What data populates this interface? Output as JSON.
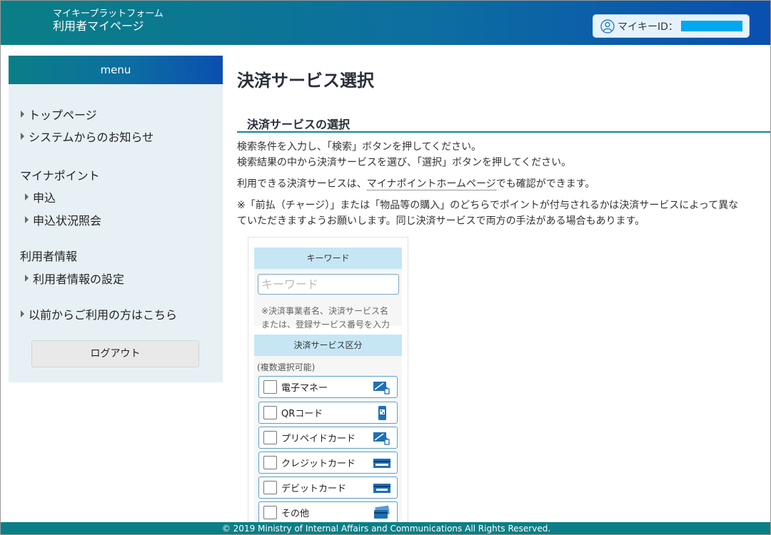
{
  "header": {
    "brand_sub": "マイキープラットフォーム",
    "brand_main": "利用者マイページ",
    "myid_label": "マイキーID："
  },
  "sidebar": {
    "menu_title": "menu",
    "items": [
      {
        "label": "トップページ"
      },
      {
        "label": "システムからのお知らせ"
      }
    ],
    "groups": [
      {
        "title": "マイナポイント",
        "items": [
          {
            "label": "申込"
          },
          {
            "label": "申込状況照会"
          }
        ]
      },
      {
        "title": "利用者情報",
        "items": [
          {
            "label": "利用者情報の設定"
          }
        ]
      }
    ],
    "previous_users": "以前からご利用の方はこちら",
    "logout_label": "ログアウト"
  },
  "main": {
    "page_title": "決済サービス選択",
    "section_title": "決済サービスの選択",
    "instruction_1": "検索条件を入力し、「検索」ボタンを押してください。",
    "instruction_2": "検索結果の中から決済サービスを選び、「選択」ボタンを押してください。",
    "available_prefix": "利用できる決済サービスは、",
    "available_link": "マイナポイントホームページ",
    "available_suffix": "でも確認ができます。",
    "note_line_1": "※「前払（チャージ）」または「物品等の購入」のどちらでポイントが付与されるかは決済サービスによって異な",
    "note_line_2": "ていただきますようお願いします。同じ決済サービスで両方の手法がある場合もあります。"
  },
  "search": {
    "keyword_header": "キーワード",
    "keyword_placeholder": "キーワード",
    "keyword_value": "",
    "keyword_note_1": "※決済事業者名、決済サービス名",
    "keyword_note_2": "または、登録サービス番号を入力",
    "type_header": "決済サービス区分",
    "multi_select": "(複数選択可能)",
    "options": [
      {
        "label": "電子マネー",
        "icon": "emoney-card-icon",
        "checked": false
      },
      {
        "label": "QRコード",
        "icon": "qr-phone-icon",
        "checked": false
      },
      {
        "label": "プリペイドカード",
        "icon": "prepaid-card-icon",
        "checked": false
      },
      {
        "label": "クレジットカード",
        "icon": "credit-card-icon",
        "checked": false
      },
      {
        "label": "デビットカード",
        "icon": "debit-card-icon",
        "checked": false
      },
      {
        "label": "その他",
        "icon": "other-cards-icon",
        "checked": false
      }
    ]
  },
  "footer": {
    "copyright": "© 2019 Ministry of Internal Affairs and Communications All Rights Reserved."
  },
  "colors": {
    "header_start": "#0a7f86",
    "header_end": "#0a4fb0",
    "accent_teal": "#0a8a90",
    "panel_header": "#c6e6f5",
    "masked_id": "#00a8f0"
  }
}
